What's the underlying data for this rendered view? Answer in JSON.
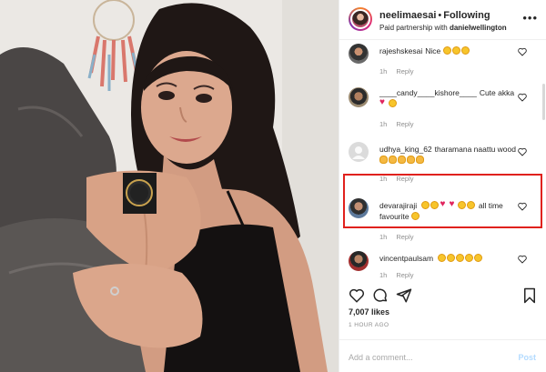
{
  "post": {
    "username": "neelimaesai",
    "separator": "•",
    "follow_status": "Following",
    "partnership_prefix": "Paid partnership with ",
    "partner": "danielwellington",
    "more_icon": "more-horizontal-icon"
  },
  "comments": [
    {
      "user": "rajeshskesai",
      "text": "Nice",
      "emoji_count": 3,
      "age": "1h",
      "reply": "Reply"
    },
    {
      "user": "____candy____kishore____",
      "text": "Cute akka",
      "emoji": [
        "heart",
        "face"
      ],
      "age": "1h",
      "reply": "Reply"
    },
    {
      "user": "udhya_king_62",
      "text": "tharamana naattu wood",
      "emoji_count": 5,
      "age": "1h",
      "reply": "Reply",
      "highlighted": true
    },
    {
      "user": "devarajiraji",
      "text": "all time favourite",
      "emoji": [
        "face",
        "face",
        "heart",
        "heart",
        "face",
        "face",
        "face"
      ],
      "age": "1h",
      "reply": "Reply"
    },
    {
      "user": "vincentpaulsam",
      "text": "",
      "emoji_count": 5,
      "age": "1h",
      "reply": "Reply"
    }
  ],
  "actions": {
    "like_icon": "heart-icon",
    "comment_icon": "comment-icon",
    "share_icon": "send-icon",
    "save_icon": "bookmark-icon"
  },
  "likes": "7,007 likes",
  "timestamp": "1 HOUR AGO",
  "composer": {
    "placeholder": "Add a comment...",
    "post_label": "Post"
  },
  "colors": {
    "highlight_border": "#e0211d",
    "post_button": "#b3dbff",
    "meta_text": "#8e8e8e"
  }
}
